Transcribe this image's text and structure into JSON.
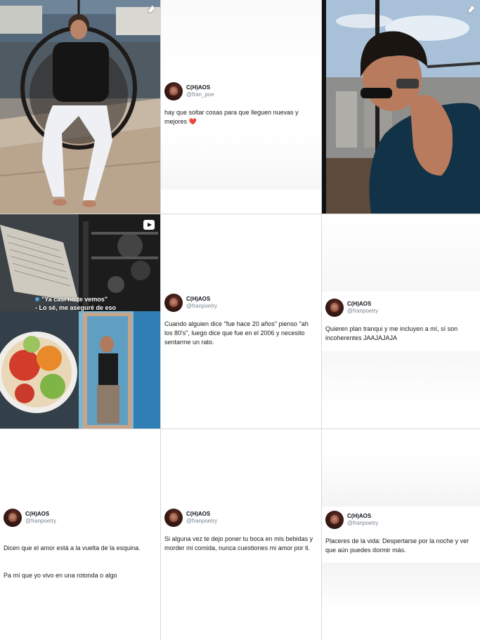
{
  "profile": {
    "display_name": "C(H)AOS",
    "handle_old": "@fran_poe",
    "handle": "@franpoetry"
  },
  "posts": [
    {
      "type": "photo",
      "subject": "man sitting in hanging chair on boat deck",
      "icon": "pin-icon"
    },
    {
      "type": "tweet",
      "display_name": "C(H)AOS",
      "handle": "@fran_poe",
      "text": "hay que soltar cosas para que lleguen nuevas y mejores ❤️"
    },
    {
      "type": "photo",
      "subject": "man with sunglasses by window overlooking city",
      "icon": "pin-icon"
    },
    {
      "type": "video",
      "icon": "play-icon",
      "caption_line1": "\"Ya casi no te vemos\"",
      "caption_line2": "- Lo sé, me aseguré de eso"
    },
    {
      "type": "tweet",
      "display_name": "C(H)AOS",
      "handle": "@franpoetry",
      "text": "Cuando alguien dice \"fue hace 20 años\" pienso \"ah los 80's\", luego dice que fue en el 2006 y necesito sentarme un rato."
    },
    {
      "type": "tweet",
      "display_name": "C(H)AOS",
      "handle": "@franpoetry",
      "text": "Quieren plan tranqui y me incluyen a mí, sí son incoherentes JAAJAJAJA"
    },
    {
      "type": "tweet",
      "display_name": "C(H)AOS",
      "handle": "@franpoetry",
      "text_p1": "Dicen que el amor está a la vuelta de la esquina.",
      "text_p2": "Pa mí que yo vivo en una rotonda o algo"
    },
    {
      "type": "tweet",
      "display_name": "C(H)AOS",
      "handle": "@franpoetry",
      "text": "Si alguna vez te dejo poner tu boca en mis bebidas y morder mi comida, nunca cuestiones mi amor por ti."
    },
    {
      "type": "tweet",
      "display_name": "C(H)AOS",
      "handle": "@franpoetry",
      "text": "Placeres de la vida: Despertarse por la noche y ver que aún puedes dormir más."
    }
  ]
}
